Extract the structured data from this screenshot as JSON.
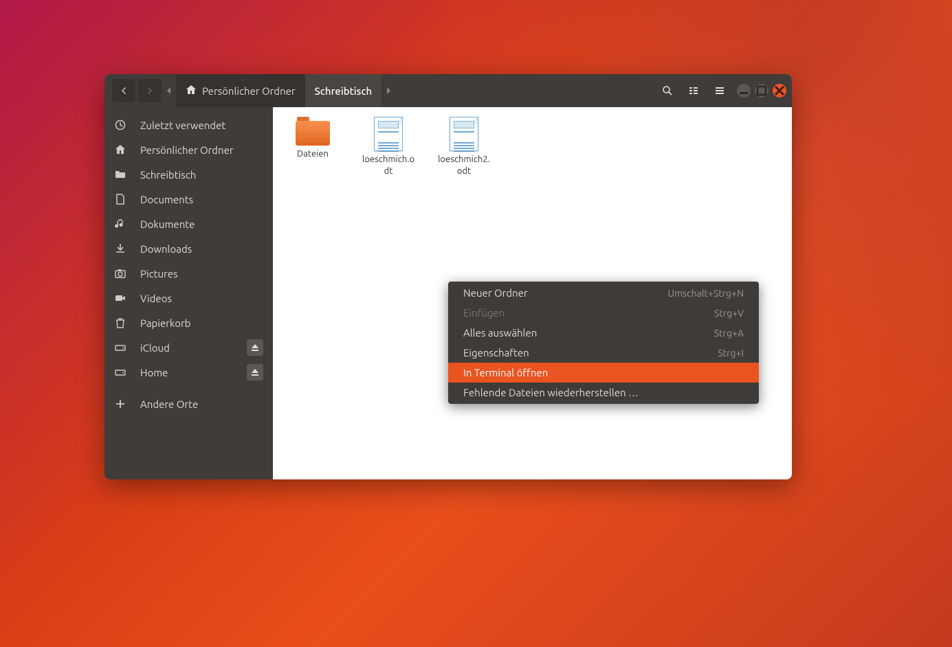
{
  "breadcrumb": {
    "parent": "Persönlicher Ordner",
    "current": "Schreibtisch"
  },
  "sidebar": {
    "items": [
      {
        "label": "Zuletzt verwendet",
        "icon": "clock",
        "eject": false
      },
      {
        "label": "Persönlicher Ordner",
        "icon": "home",
        "eject": false
      },
      {
        "label": "Schreibtisch",
        "icon": "folder",
        "eject": false
      },
      {
        "label": "Documents",
        "icon": "document",
        "eject": false
      },
      {
        "label": "Dokumente",
        "icon": "music",
        "eject": false
      },
      {
        "label": "Downloads",
        "icon": "download",
        "eject": false
      },
      {
        "label": "Pictures",
        "icon": "camera",
        "eject": false
      },
      {
        "label": "Videos",
        "icon": "video",
        "eject": false
      },
      {
        "label": "Papierkorb",
        "icon": "trash",
        "eject": false
      },
      {
        "label": "iCloud",
        "icon": "drive",
        "eject": true
      },
      {
        "label": "Home",
        "icon": "drive",
        "eject": true
      },
      {
        "label": "Andere Orte",
        "icon": "plus",
        "eject": false
      }
    ]
  },
  "files": [
    {
      "name": "Dateien",
      "type": "folder"
    },
    {
      "name": "loeschmich.odt",
      "type": "document"
    },
    {
      "name": "loeschmich2.odt",
      "type": "document"
    }
  ],
  "context_menu": [
    {
      "label": "Neuer Ordner",
      "shortcut": "Umschalt+Strg+N",
      "disabled": false,
      "hover": false
    },
    {
      "label": "Einfügen",
      "shortcut": "Strg+V",
      "disabled": true,
      "hover": false
    },
    {
      "label": "Alles auswählen",
      "shortcut": "Strg+A",
      "disabled": false,
      "hover": false
    },
    {
      "label": "Eigenschaften",
      "shortcut": "Strg+I",
      "disabled": false,
      "hover": false
    },
    {
      "label": "In Terminal öffnen",
      "shortcut": "",
      "disabled": false,
      "hover": true
    },
    {
      "label": "Fehlende Dateien wiederherstellen …",
      "shortcut": "",
      "disabled": false,
      "hover": false
    }
  ]
}
